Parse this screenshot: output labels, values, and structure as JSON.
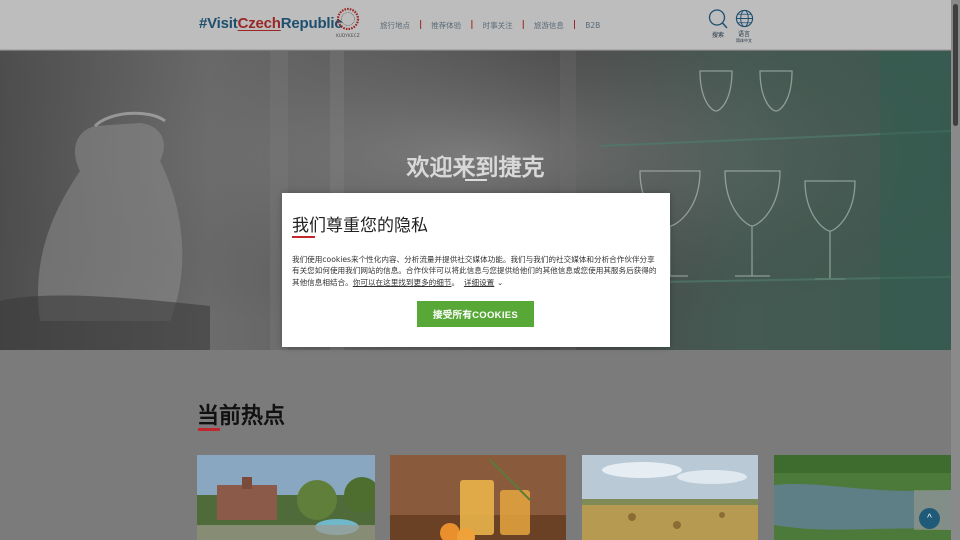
{
  "header": {
    "logo": {
      "prefix": "#Visit",
      "highlight": "Czech",
      "suffix": "Republic"
    },
    "seal_text": "KUDYKECZ",
    "nav": [
      "旅行地点",
      "推荐体验",
      "时事关注",
      "旅游信息",
      "B2B"
    ],
    "search_label": "搜索",
    "language_label": "语言",
    "language_value": "简体中文"
  },
  "hero": {
    "title": "欢迎来到捷克"
  },
  "cookie_dialog": {
    "title": "我们尊重您的隐私",
    "body": "我们使用cookies来个性化内容、分析流量并提供社交媒体功能。我们与我们的社交媒体和分析合作伙伴分享有关您如何使用我们网站的信息。合作伙伴可以将此信息与您提供给他们的其他信息或您使用其服务后获得的其他信息相结合。",
    "more_link": "你可以在这里找到更多的细节",
    "period": "。",
    "details": "详细设置",
    "accept": "接受所有COOKIES"
  },
  "section": {
    "title": "当前热点"
  },
  "colors": {
    "accent_red": "#c1272d",
    "accept_green": "#58a838",
    "brand_blue": "#1e4f6e"
  }
}
